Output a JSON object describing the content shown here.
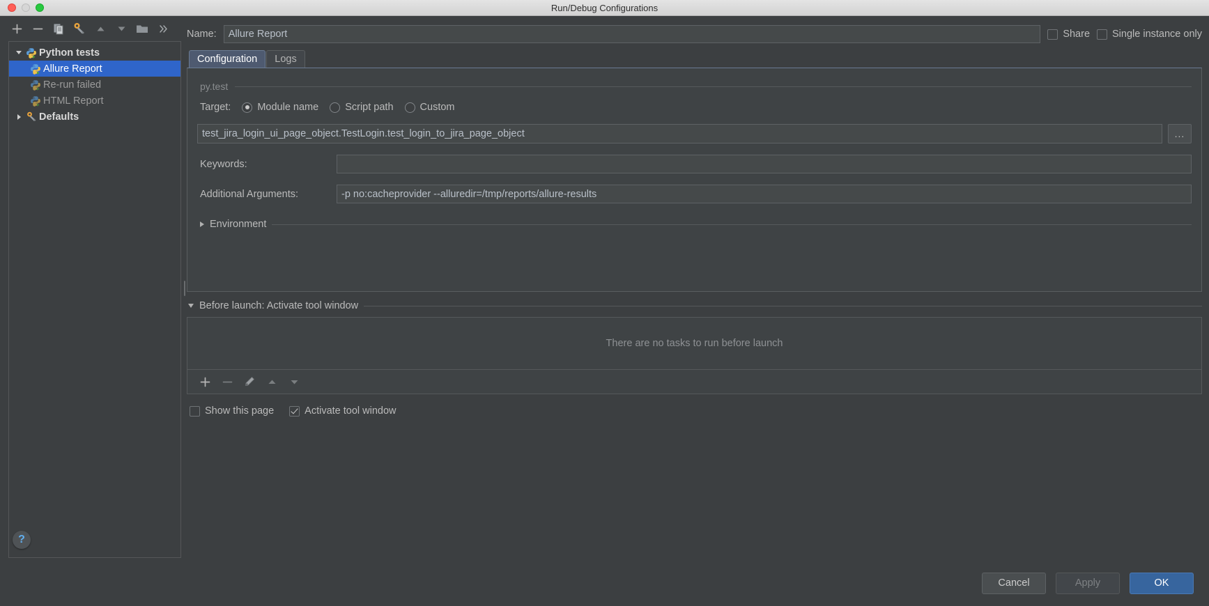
{
  "window": {
    "title": "Run/Debug Configurations",
    "traffic_lights": [
      "close-button",
      "minimize-button",
      "zoom-button"
    ]
  },
  "left_toolbar": {
    "buttons": [
      {
        "name": "add-configuration-button",
        "icon": "plus-icon",
        "label": "+"
      },
      {
        "name": "remove-configuration-button",
        "icon": "minus-icon",
        "label": "−"
      },
      {
        "name": "copy-configuration-button",
        "icon": "copy-icon",
        "label": "Copy"
      },
      {
        "name": "edit-defaults-button",
        "icon": "wrench-icon",
        "label": "Edit defaults"
      },
      {
        "name": "move-up-button",
        "icon": "arrow-up-icon",
        "label": "Move Up"
      },
      {
        "name": "move-down-button",
        "icon": "arrow-down-icon",
        "label": "Move Down"
      },
      {
        "name": "create-folder-button",
        "icon": "folder-icon",
        "label": "Create folder"
      },
      {
        "name": "more-options-button",
        "icon": "chevron-double-right-icon",
        "label": "»"
      }
    ]
  },
  "tree": {
    "nodes": [
      {
        "label": "Python tests",
        "type": "group",
        "expanded": true,
        "icon": "python-test-icon",
        "selected": false
      },
      {
        "label": "Allure Report",
        "type": "child",
        "icon": "python-test-icon",
        "selected": true
      },
      {
        "label": "Re-run failed",
        "type": "child",
        "icon": "python-test-icon",
        "selected": false
      },
      {
        "label": "HTML Report",
        "type": "child",
        "icon": "python-test-icon",
        "selected": false
      },
      {
        "label": "Defaults",
        "type": "group",
        "expanded": false,
        "icon": "wrench-icon",
        "selected": false
      }
    ]
  },
  "help": {
    "label": "?"
  },
  "name_row": {
    "label": "Name:",
    "value": "Allure Report",
    "placeholder": "",
    "share": {
      "label": "Share",
      "checked": false
    },
    "single_instance": {
      "label": "Single instance only",
      "checked": false
    }
  },
  "tabs": [
    {
      "label": "Configuration",
      "active": true
    },
    {
      "label": "Logs",
      "active": false
    }
  ],
  "configuration": {
    "section_title": "py.test",
    "target": {
      "label": "Target:",
      "options": [
        {
          "label": "Module name",
          "selected": true
        },
        {
          "label": "Script path",
          "selected": false
        },
        {
          "label": "Custom",
          "selected": false
        }
      ],
      "value": "test_jira_login_ui_page_object.TestLogin.test_login_to_jira_page_object",
      "browse_label": "..."
    },
    "keywords": {
      "label": "Keywords:",
      "value": "",
      "placeholder": ""
    },
    "additional_arguments": {
      "label": "Additional Arguments:",
      "value": "-p no:cacheprovider --alluredir=/tmp/reports/allure-results",
      "placeholder": ""
    },
    "environment": {
      "label": "Environment",
      "expanded": false
    }
  },
  "before_launch": {
    "header": "Before launch: Activate tool window",
    "expanded": true,
    "empty_text": "There are no tasks to run before launch",
    "toolbar": [
      {
        "name": "add-task-button",
        "icon": "plus-icon",
        "enabled": true
      },
      {
        "name": "remove-task-button",
        "icon": "minus-icon",
        "enabled": false
      },
      {
        "name": "edit-task-button",
        "icon": "pencil-icon",
        "enabled": false
      },
      {
        "name": "move-task-up-button",
        "icon": "arrow-up-icon",
        "enabled": false
      },
      {
        "name": "move-task-down-button",
        "icon": "arrow-down-icon",
        "enabled": false
      }
    ],
    "show_this_page": {
      "label": "Show this page",
      "checked": false
    },
    "activate_tool_window": {
      "label": "Activate tool window",
      "checked": true
    }
  },
  "footer": {
    "cancel": "Cancel",
    "apply": "Apply",
    "ok": "OK"
  },
  "colors": {
    "background": "#3c3f41",
    "panel": "#3f4345",
    "selection": "#2f65ca",
    "accent_primary": "#37659e",
    "tab_active": "#4e5a70",
    "text": "#bbbbbb",
    "muted_text": "#8e9194",
    "help_icon": "#61afef"
  }
}
